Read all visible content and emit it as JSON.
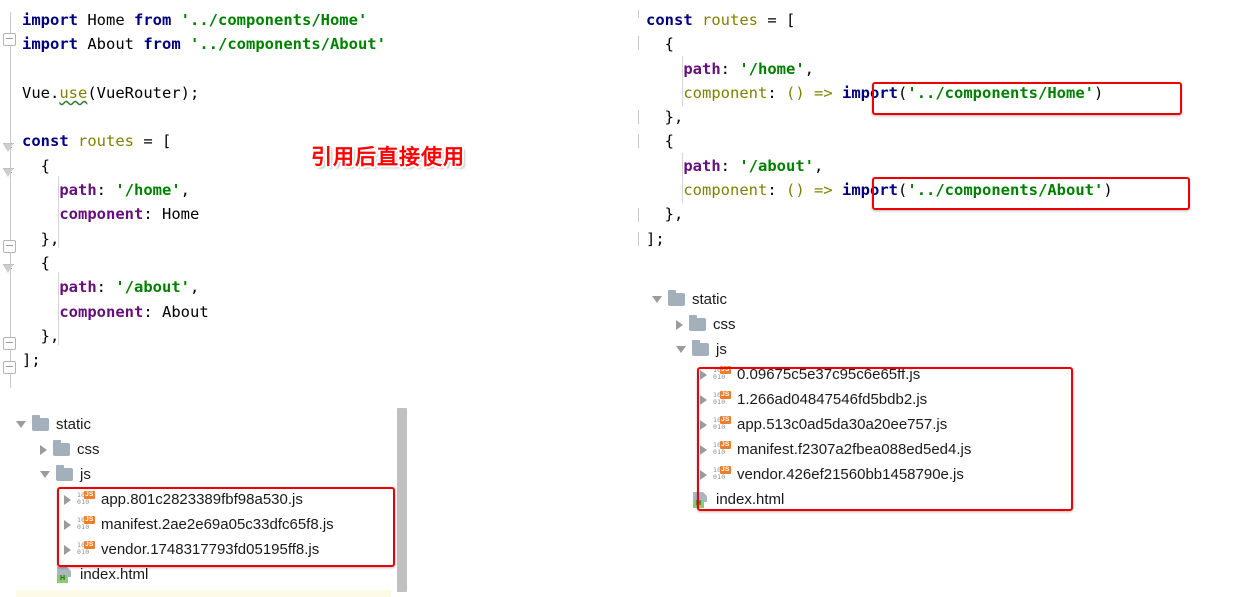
{
  "left_editor": {
    "name": "router-eager-import-code",
    "lines": [
      {
        "indent": 0,
        "tokens": [
          {
            "t": "import",
            "c": "kw"
          },
          {
            "t": " Home ",
            "c": "plain"
          },
          {
            "t": "from",
            "c": "kw"
          },
          {
            "t": " ",
            "c": "plain"
          },
          {
            "t": "'../components/Home'",
            "c": "str"
          }
        ]
      },
      {
        "indent": 0,
        "tokens": [
          {
            "t": "import",
            "c": "kw"
          },
          {
            "t": " About ",
            "c": "plain"
          },
          {
            "t": "from",
            "c": "kw"
          },
          {
            "t": " ",
            "c": "plain"
          },
          {
            "t": "'../components/About'",
            "c": "str"
          }
        ]
      },
      {
        "indent": 0,
        "tokens": []
      },
      {
        "indent": 0,
        "tokens": [
          {
            "t": "Vue.",
            "c": "plain"
          },
          {
            "t": "use",
            "c": "squig"
          },
          {
            "t": "(VueRouter);",
            "c": "plain"
          }
        ]
      },
      {
        "indent": 0,
        "tokens": []
      },
      {
        "indent": 0,
        "tokens": [
          {
            "t": "const",
            "c": "kw"
          },
          {
            "t": " ",
            "c": "plain"
          },
          {
            "t": "routes",
            "c": "id"
          },
          {
            "t": " = [",
            "c": "plain"
          }
        ]
      },
      {
        "indent": 1,
        "tokens": [
          {
            "t": "{",
            "c": "plain"
          }
        ]
      },
      {
        "indent": 2,
        "tokens": [
          {
            "t": "path",
            "c": "prop"
          },
          {
            "t": ": ",
            "c": "plain"
          },
          {
            "t": "'/home'",
            "c": "str"
          },
          {
            "t": ",",
            "c": "plain"
          }
        ]
      },
      {
        "indent": 2,
        "tokens": [
          {
            "t": "component",
            "c": "prop"
          },
          {
            "t": ": Home",
            "c": "plain"
          }
        ]
      },
      {
        "indent": 1,
        "tokens": [
          {
            "t": "},",
            "c": "plain"
          }
        ]
      },
      {
        "indent": 1,
        "tokens": [
          {
            "t": "{",
            "c": "plain"
          }
        ]
      },
      {
        "indent": 2,
        "tokens": [
          {
            "t": "path",
            "c": "prop"
          },
          {
            "t": ": ",
            "c": "plain"
          },
          {
            "t": "'/about'",
            "c": "str"
          },
          {
            "t": ",",
            "c": "plain"
          }
        ]
      },
      {
        "indent": 2,
        "tokens": [
          {
            "t": "component",
            "c": "prop"
          },
          {
            "t": ": About",
            "c": "plain"
          }
        ]
      },
      {
        "indent": 1,
        "tokens": [
          {
            "t": "},",
            "c": "plain"
          }
        ]
      },
      {
        "indent": 0,
        "tokens": [
          {
            "t": "];",
            "c": "plain"
          }
        ]
      }
    ]
  },
  "annotation": {
    "text": "引用后直接使用",
    "color": "#ff0000"
  },
  "right_editor": {
    "name": "router-lazy-import-code",
    "lines": [
      {
        "indent": 0,
        "tokens": [
          {
            "t": "const",
            "c": "kw"
          },
          {
            "t": " ",
            "c": "plain"
          },
          {
            "t": "routes",
            "c": "id"
          },
          {
            "t": " = [",
            "c": "plain"
          }
        ]
      },
      {
        "indent": 1,
        "tokens": [
          {
            "t": "{",
            "c": "plain"
          }
        ]
      },
      {
        "indent": 2,
        "tokens": [
          {
            "t": "path",
            "c": "prop"
          },
          {
            "t": ": ",
            "c": "plain"
          },
          {
            "t": "'/home'",
            "c": "str"
          },
          {
            "t": ",",
            "c": "plain"
          }
        ]
      },
      {
        "indent": 2,
        "tokens": [
          {
            "t": "component",
            "c": "id"
          },
          {
            "t": ": ",
            "c": "plain"
          },
          {
            "t": "() =>",
            "c": "id"
          },
          {
            "t": " ",
            "c": "plain"
          },
          {
            "t": "import",
            "c": "kw"
          },
          {
            "t": "(",
            "c": "plain"
          },
          {
            "t": "'../components/Home'",
            "c": "str"
          },
          {
            "t": ")",
            "c": "plain"
          }
        ]
      },
      {
        "indent": 1,
        "tokens": [
          {
            "t": "},",
            "c": "plain"
          }
        ]
      },
      {
        "indent": 1,
        "tokens": [
          {
            "t": "{",
            "c": "plain"
          }
        ]
      },
      {
        "indent": 2,
        "tokens": [
          {
            "t": "path",
            "c": "prop"
          },
          {
            "t": ": ",
            "c": "plain"
          },
          {
            "t": "'/about'",
            "c": "str"
          },
          {
            "t": ",",
            "c": "plain"
          }
        ]
      },
      {
        "indent": 2,
        "tokens": [
          {
            "t": "component",
            "c": "id"
          },
          {
            "t": ": ",
            "c": "plain"
          },
          {
            "t": "() =>",
            "c": "id"
          },
          {
            "t": " ",
            "c": "plain"
          },
          {
            "t": "import",
            "c": "kw"
          },
          {
            "t": "(",
            "c": "plain"
          },
          {
            "t": "'../components/About'",
            "c": "str"
          },
          {
            "t": ")",
            "c": "plain"
          }
        ]
      },
      {
        "indent": 1,
        "tokens": [
          {
            "t": "},",
            "c": "plain"
          }
        ]
      },
      {
        "indent": 0,
        "tokens": [
          {
            "t": "];",
            "c": "plain"
          }
        ]
      }
    ]
  },
  "left_tree": {
    "name": "build-output-tree-eager",
    "rows": [
      {
        "depth": 0,
        "arrow": "expanded",
        "icon": "folder",
        "label": "static"
      },
      {
        "depth": 1,
        "arrow": "collapsed",
        "icon": "folder",
        "label": "css"
      },
      {
        "depth": 1,
        "arrow": "expanded",
        "icon": "folder",
        "label": "js"
      },
      {
        "depth": 2,
        "arrow": "collapsed",
        "icon": "js",
        "label": "app.801c2823389fbf98a530.js"
      },
      {
        "depth": 2,
        "arrow": "collapsed",
        "icon": "js",
        "label": "manifest.2ae2e69a05c33dfc65f8.js"
      },
      {
        "depth": 2,
        "arrow": "collapsed",
        "icon": "js",
        "label": "vendor.1748317793fd05195ff8.js"
      },
      {
        "depth": 1,
        "arrow": "none",
        "icon": "html",
        "label": "index.html"
      }
    ]
  },
  "right_tree": {
    "name": "build-output-tree-lazy",
    "rows": [
      {
        "depth": 0,
        "arrow": "expanded",
        "icon": "folder",
        "label": "static"
      },
      {
        "depth": 1,
        "arrow": "collapsed",
        "icon": "folder",
        "label": "css"
      },
      {
        "depth": 1,
        "arrow": "expanded",
        "icon": "folder",
        "label": "js"
      },
      {
        "depth": 2,
        "arrow": "collapsed",
        "icon": "js",
        "label": "0.09675c5e37c95c6e65ff.js"
      },
      {
        "depth": 2,
        "arrow": "collapsed",
        "icon": "js",
        "label": "1.266ad04847546fd5bdb2.js"
      },
      {
        "depth": 2,
        "arrow": "collapsed",
        "icon": "js",
        "label": "app.513c0ad5da30a20ee757.js"
      },
      {
        "depth": 2,
        "arrow": "collapsed",
        "icon": "js",
        "label": "manifest.f2307a2fbea088ed5ed4.js"
      },
      {
        "depth": 2,
        "arrow": "collapsed",
        "icon": "js",
        "label": "vendor.426ef21560bb1458790e.js"
      },
      {
        "depth": 1,
        "arrow": "none",
        "icon": "html",
        "label": "index.html"
      }
    ]
  },
  "js_icon": {
    "top": "10",
    "bottom": "010",
    "badge": "JS"
  },
  "html_icon": {
    "badge": "H"
  },
  "highlight_color": "#ee0000"
}
